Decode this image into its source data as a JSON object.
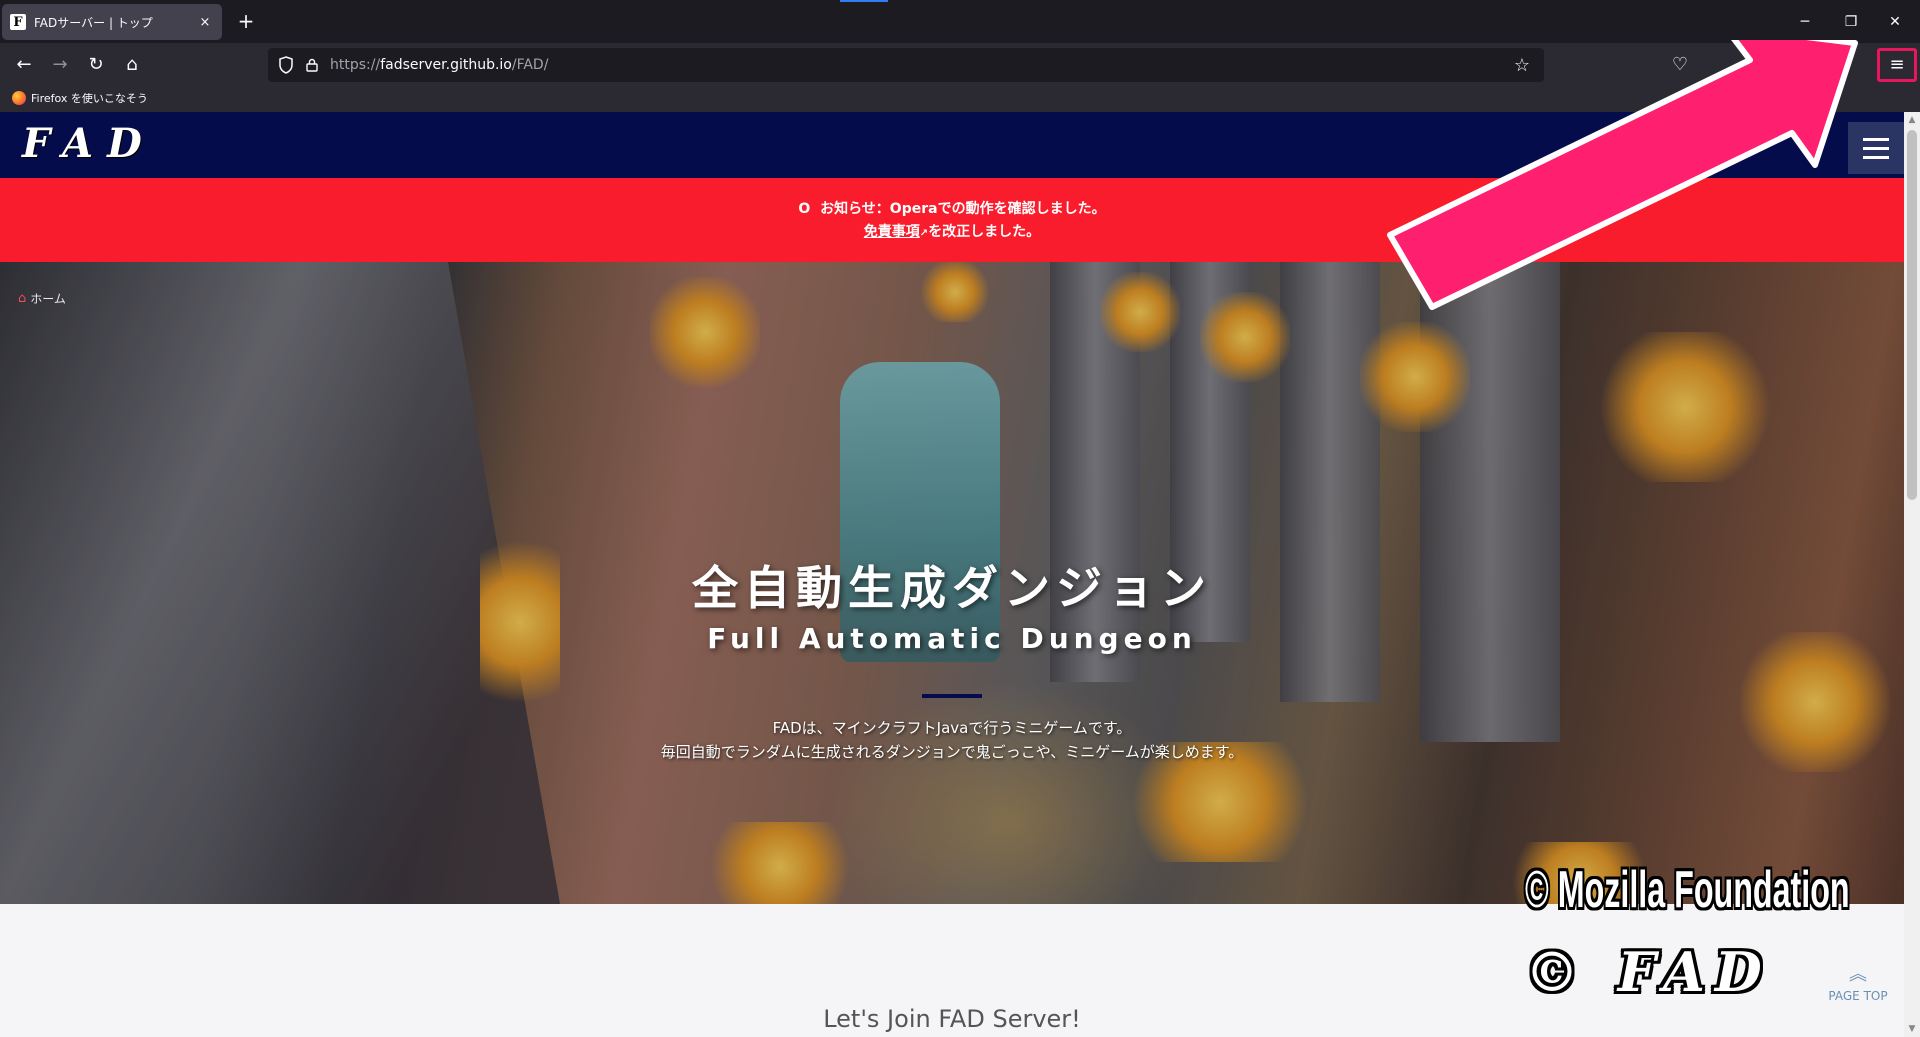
{
  "browser": {
    "tab_title": "FADサーバー | トップ",
    "tab_favicon": "F",
    "tab_close": "×",
    "new_tab": "+",
    "url_prefix": "https://",
    "url_host": "fadserver.github.io",
    "url_path": "/FAD/",
    "bookmark_label": "Firefox を使いこなそう",
    "menu_glyph": "≡"
  },
  "site": {
    "logo": "FAD",
    "notice_line1": "お知らせ：Operaでの動作を確認しました。",
    "notice_link": "免責事項",
    "notice_line2_rest": "を改正しました。",
    "breadcrumb_home": "ホーム",
    "hero_title": "全自動生成ダンジョン",
    "hero_subtitle": "Full Automatic Dungeon",
    "hero_desc1": "FADは、マインクラフトJavaで行うミニゲームです。",
    "hero_desc2": "毎回自動でランダムに生成されるダンジョンで鬼ごっこや、ミニゲームが楽しめます。",
    "join_heading": "Let's Join FAD Server!",
    "page_top": "PAGE TOP"
  },
  "overlay": {
    "copyright_mozilla": "© Mozilla Foundation",
    "copyright_fad": "© FAD",
    "arrow_color": "#ff1f6f"
  },
  "colors": {
    "header_navy": "#050c4b",
    "notice_red": "#f91c2c",
    "highlight_pink": "#e8175d"
  }
}
